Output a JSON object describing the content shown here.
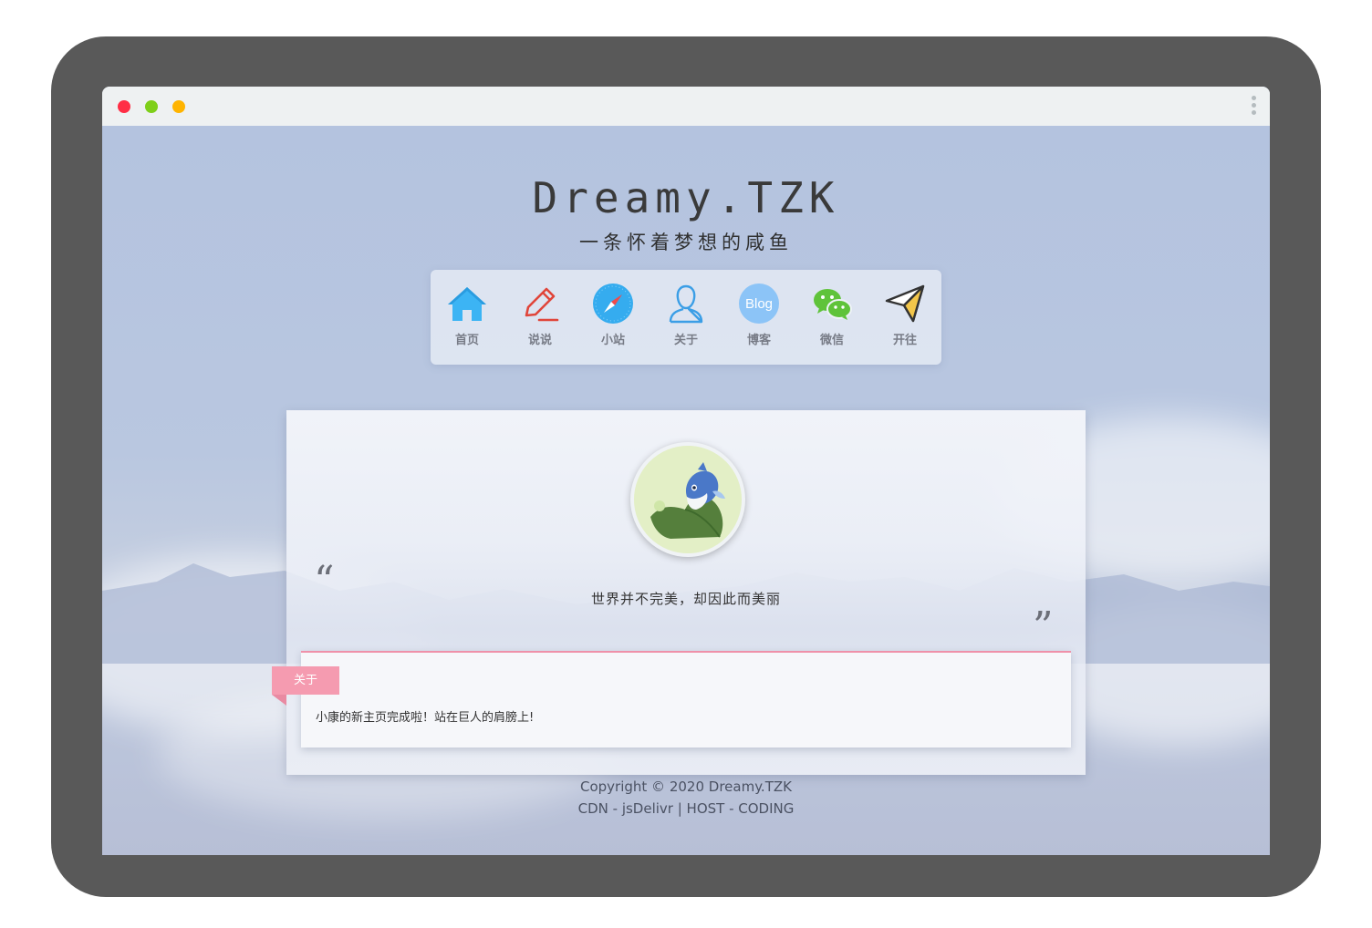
{
  "site": {
    "title": "Dreamy.TZK",
    "subtitle": "一条怀着梦想的咸鱼"
  },
  "nav": {
    "items": [
      {
        "label": "首页",
        "icon": "home-icon"
      },
      {
        "label": "说说",
        "icon": "pencil-icon"
      },
      {
        "label": "小站",
        "icon": "compass-icon"
      },
      {
        "label": "关于",
        "icon": "user-icon"
      },
      {
        "label": "博客",
        "icon": "blog-icon",
        "icon_text": "Blog"
      },
      {
        "label": "微信",
        "icon": "wechat-icon"
      },
      {
        "label": "开往",
        "icon": "paper-plane-icon"
      }
    ]
  },
  "card": {
    "motto": "世界并不完美，却因此而美丽",
    "quote_open": "“",
    "quote_close": "”",
    "panel": {
      "tag": "关于",
      "text": "小康的新主页完成啦！站在巨人的肩膀上!"
    }
  },
  "footer": {
    "copyright": "Copyright © 2020 Dreamy.TZK",
    "hosting": "CDN - jsDelivr | HOST - CODING"
  },
  "colors": {
    "accent_pink": "#f59bb0",
    "nav_home_blue": "#3cb4f4",
    "nav_pencil_red": "#e0453a",
    "wechat_green": "#5fc33a",
    "blog_blue": "#8cc4f7"
  }
}
